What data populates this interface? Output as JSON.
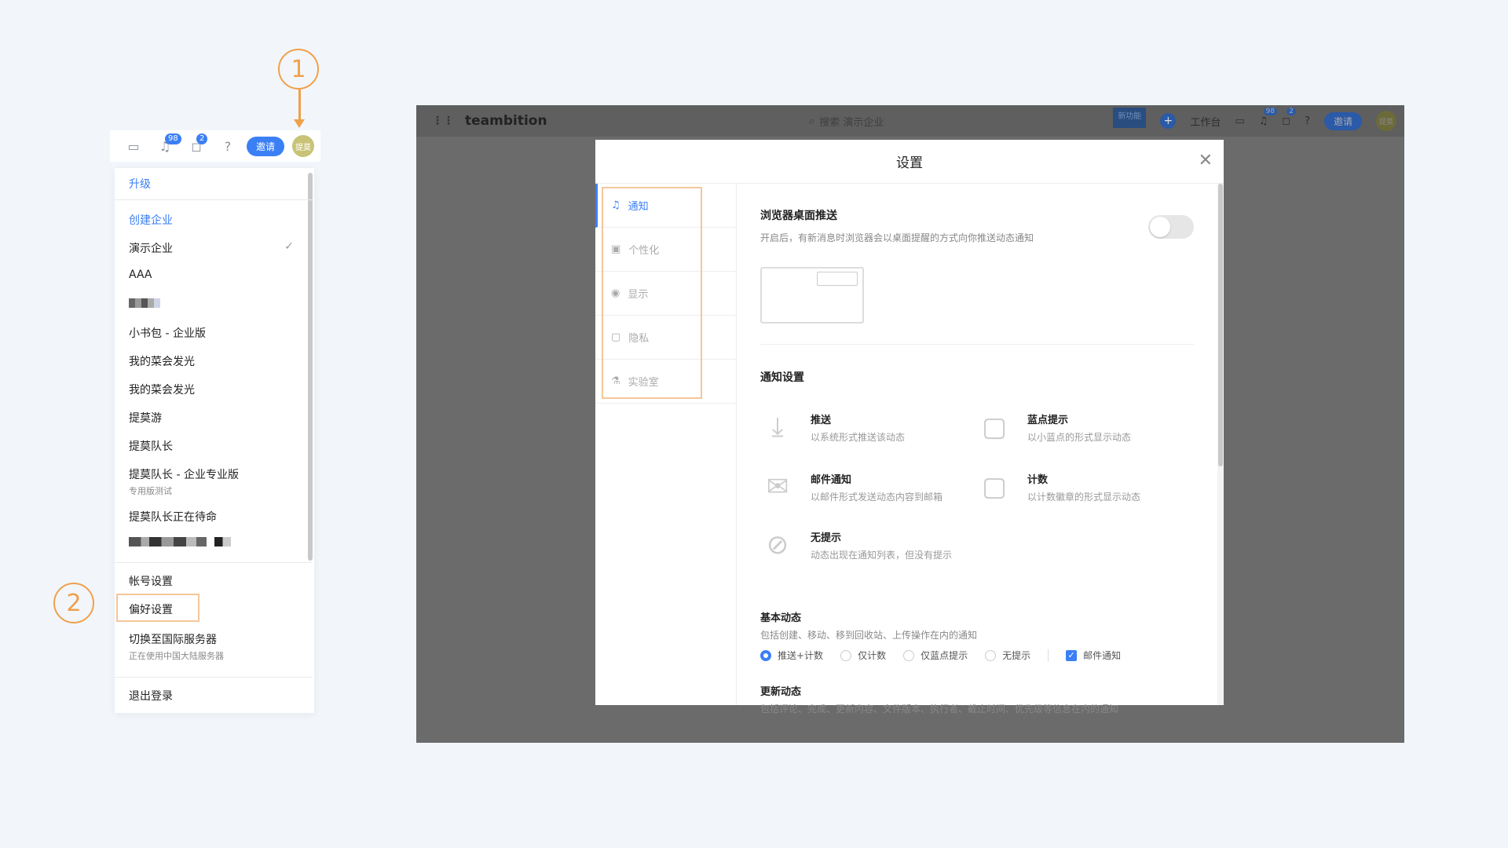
{
  "steps": {
    "one": "1",
    "two": "2"
  },
  "mini_topbar": {
    "notif_count": "98",
    "msg_count": "2",
    "invite_label": "邀请",
    "avatar_label": "提莫"
  },
  "dropdown": {
    "upgrade": "升级",
    "create_org": "创建企业",
    "orgs": [
      "演示企业",
      "AAA",
      "小书包 - 企业版",
      "我的菜会发光",
      "我的菜会发光",
      "提莫游",
      "提莫队长"
    ],
    "org_pro": {
      "name": "提莫队长 - 企业专业版",
      "sub": "专用版测试"
    },
    "org_last": "提莫队长正在待命",
    "account_settings": "帐号设置",
    "preferences": "偏好设置",
    "switch_server": {
      "label": "切换至国际服务器",
      "sub": "正在使用中国大陆服务器"
    },
    "logout": "退出登录"
  },
  "app": {
    "logo": "teambition",
    "search_placeholder": "搜索 演示企业",
    "new_feature": "新功能",
    "workbench": "工作台",
    "notif_count": "98",
    "msg_count": "2",
    "invite": "邀请",
    "avatar": "提莫"
  },
  "modal": {
    "title": "设置",
    "tabs": [
      "通知",
      "个性化",
      "显示",
      "隐私",
      "实验室"
    ],
    "browser_push": {
      "title": "浏览器桌面推送",
      "desc": "开启后，有新消息时浏览器会以桌面提醒的方式向你推送动态通知"
    },
    "notif_settings_title": "通知设置",
    "options": [
      {
        "title": "推送",
        "desc": "以系统形式推送该动态"
      },
      {
        "title": "蓝点提示",
        "desc": "以小蓝点的形式显示动态"
      },
      {
        "title": "邮件通知",
        "desc": "以邮件形式发送动态内容到邮箱"
      },
      {
        "title": "计数",
        "desc": "以计数徽章的形式显示动态"
      },
      {
        "title": "无提示",
        "desc": "动态出现在通知列表，但没有提示"
      }
    ],
    "basic": {
      "title": "基本动态",
      "desc": "包括创建、移动、移到回收站、上传操作在内的通知",
      "radios": [
        "推送+计数",
        "仅计数",
        "仅蓝点提示",
        "无提示"
      ],
      "checkbox": "邮件通知"
    },
    "update": {
      "title": "更新动态",
      "desc": "包括评论、完成、更新内容、文件版本、执行者、截止时间、优先级等信息在内的通知"
    }
  }
}
